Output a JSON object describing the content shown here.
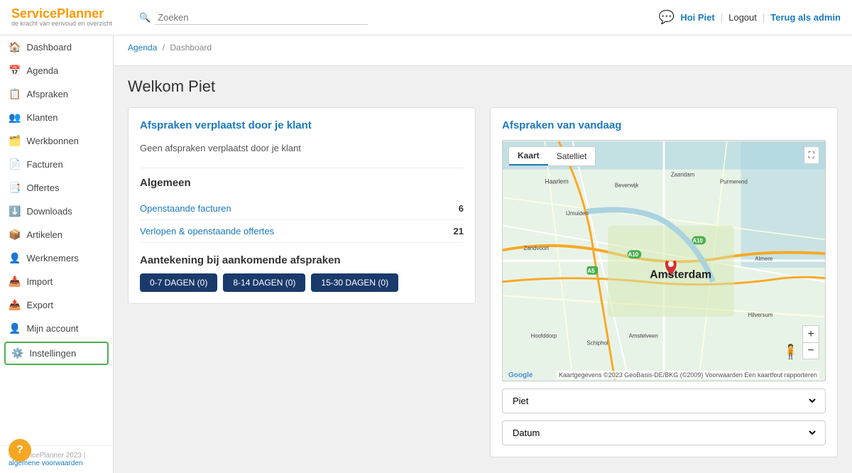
{
  "header": {
    "logo_main_1": "Service",
    "logo_main_2": "Planner",
    "logo_sub": "de kracht van eenvoud en overzicht",
    "search_placeholder": "Zoeken",
    "greeting": "Hoi Piet",
    "logout_label": "Logout",
    "back_admin_label": "Terug als admin"
  },
  "sidebar": {
    "items": [
      {
        "id": "dashboard",
        "label": "Dashboard",
        "icon": "🏠"
      },
      {
        "id": "agenda",
        "label": "Agenda",
        "icon": "📅"
      },
      {
        "id": "afspraken",
        "label": "Afspraken",
        "icon": "📋"
      },
      {
        "id": "klanten",
        "label": "Klanten",
        "icon": "👥"
      },
      {
        "id": "werkbonnen",
        "label": "Werkbonnen",
        "icon": "🗂️"
      },
      {
        "id": "facturen",
        "label": "Facturen",
        "icon": "📄"
      },
      {
        "id": "offertes",
        "label": "Offertes",
        "icon": "📑"
      },
      {
        "id": "downloads",
        "label": "Downloads",
        "icon": "⬇️"
      },
      {
        "id": "artikelen",
        "label": "Artikelen",
        "icon": "📦"
      },
      {
        "id": "werknemers",
        "label": "Werknemers",
        "icon": "👤"
      },
      {
        "id": "import",
        "label": "Import",
        "icon": "📥"
      },
      {
        "id": "export",
        "label": "Export",
        "icon": "📤"
      },
      {
        "id": "mijn-account",
        "label": "Mijn account",
        "icon": "👤"
      },
      {
        "id": "instellingen",
        "label": "Instellingen",
        "icon": "⚙️"
      }
    ],
    "footer_text": "© ServicePlanner 2023 |",
    "footer_link_text": "algemene voorwaarden"
  },
  "breadcrumb": {
    "items": [
      {
        "label": "Agenda",
        "link": true
      },
      {
        "label": "Dashboard",
        "link": false
      }
    ]
  },
  "page": {
    "title": "Welkom Piet"
  },
  "left_panel": {
    "appointments_moved_title": "Afspraken verplaatst door je klant",
    "no_appointments_text": "Geen afspraken verplaatst door je klant",
    "general_title": "Algemeen",
    "stats": [
      {
        "label": "Openstaande facturen",
        "value": "6"
      },
      {
        "label": "Verlopen & openstaande offertes",
        "value": "21"
      }
    ],
    "annotation_title": "Aantekening bij aankomende afspraken",
    "day_buttons": [
      {
        "label": "0-7 DAGEN (0)"
      },
      {
        "label": "8-14 DAGEN (0)"
      },
      {
        "label": "15-30 DAGEN (0)"
      }
    ]
  },
  "right_panel": {
    "appointments_today_title": "Afspraken van vandaag",
    "map_tabs": [
      {
        "label": "Kaart",
        "active": true
      },
      {
        "label": "Satelliet",
        "active": false
      }
    ],
    "employee_dropdown": {
      "value": "Piet",
      "options": [
        "Piet"
      ]
    },
    "date_dropdown": {
      "value": "Datum",
      "options": [
        "Datum"
      ]
    }
  },
  "help_button_label": "?"
}
